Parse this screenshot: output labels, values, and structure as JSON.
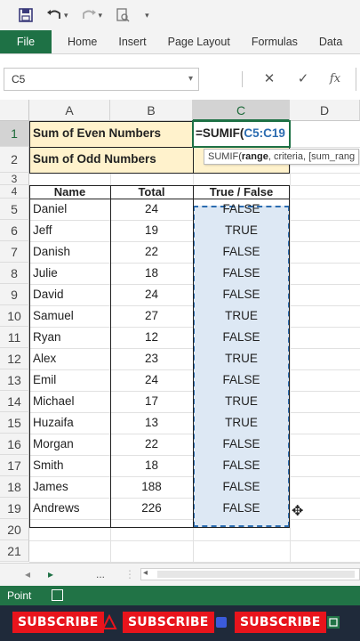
{
  "toolbar": {
    "icons": [
      "save-icon",
      "undo-icon",
      "redo-icon",
      "print-preview-icon",
      "customize-icon"
    ]
  },
  "ribbon": {
    "tabs": [
      "File",
      "Home",
      "Insert",
      "Page Layout",
      "Formulas",
      "Data"
    ]
  },
  "formula_bar": {
    "name_box": "C5",
    "cancel": "✕",
    "enter": "✓",
    "fx": "fx"
  },
  "columns": [
    "A",
    "B",
    "C",
    "D"
  ],
  "rows": [
    "1",
    "2",
    "3",
    "4",
    "5",
    "6",
    "7",
    "8",
    "9",
    "10",
    "11",
    "12",
    "13",
    "14",
    "15",
    "16",
    "17",
    "18",
    "19",
    "20",
    "21"
  ],
  "summary": {
    "even_label": "Sum of Even Numbers",
    "odd_label": "Sum of Odd Numbers",
    "formula_prefix": "=SUMIF(",
    "formula_ref": "C5:C19"
  },
  "tooltip": {
    "func": "SUMIF(",
    "arg1": "range",
    "rest": ", criteria, [sum_rang"
  },
  "table": {
    "headers": [
      "Name",
      "Total",
      "True / False"
    ],
    "rows": [
      [
        "Daniel",
        "24",
        "FALSE"
      ],
      [
        "Jeff",
        "19",
        "TRUE"
      ],
      [
        "Danish",
        "22",
        "FALSE"
      ],
      [
        "Julie",
        "18",
        "FALSE"
      ],
      [
        "David",
        "24",
        "FALSE"
      ],
      [
        "Samuel",
        "27",
        "TRUE"
      ],
      [
        "Ryan",
        "12",
        "FALSE"
      ],
      [
        "Alex",
        "23",
        "TRUE"
      ],
      [
        "Emil",
        "24",
        "FALSE"
      ],
      [
        "Michael",
        "17",
        "TRUE"
      ],
      [
        "Huzaifa",
        "13",
        "TRUE"
      ],
      [
        "Morgan",
        "22",
        "FALSE"
      ],
      [
        "Smith",
        "18",
        "FALSE"
      ],
      [
        "James",
        "188",
        "FALSE"
      ],
      [
        "Andrews",
        "226",
        "FALSE"
      ]
    ]
  },
  "sheet_nav": {
    "prev": "◂",
    "next": "▸",
    "more": "..."
  },
  "status": {
    "mode": "Point"
  },
  "taskbar": {
    "subscribe_1": "SUBSCRIBE",
    "subscribe_2": "SUBSCRIBE",
    "subscribe_3": "SUBSCRIBE"
  },
  "colors": {
    "excel_green": "#217346",
    "highlight": "#fff2cc",
    "selection": "#dde8f4",
    "ref_blue": "#2b6cb0",
    "subscribe_red": "#e8141c"
  }
}
